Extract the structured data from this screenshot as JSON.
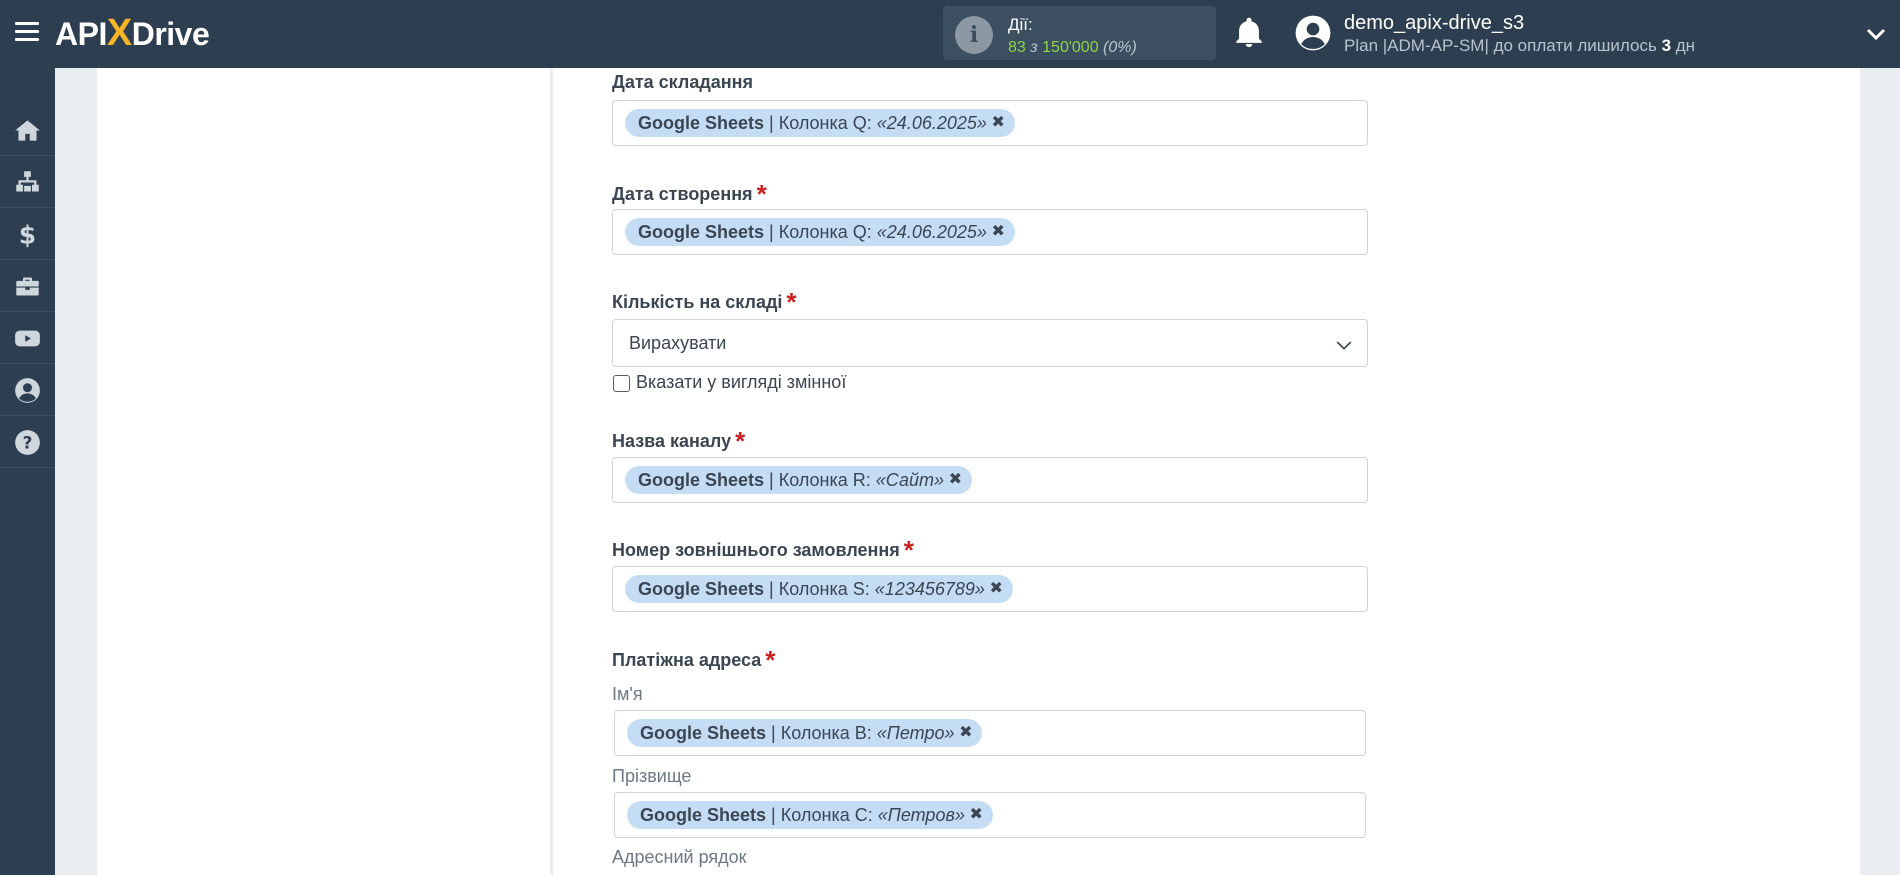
{
  "app": {
    "logo_pre": "API",
    "logo_x": "X",
    "logo_post": "Drive"
  },
  "header": {
    "actions_label": "Дії:",
    "actions_used": "83",
    "actions_of": "з",
    "actions_total": "150'000",
    "actions_percent": "(0%)",
    "user_name": "demo_apix-drive_s3",
    "plan_prefix": "Plan |ADM-AP-SM| до оплати лишилось",
    "plan_days": "3",
    "plan_suffix": "дн"
  },
  "sidebar": {
    "items": [
      {
        "name": "home-icon"
      },
      {
        "name": "sitemap-icon"
      },
      {
        "name": "dollar-icon"
      },
      {
        "name": "briefcase-icon"
      },
      {
        "name": "youtube-icon"
      },
      {
        "name": "user-circle-icon"
      },
      {
        "name": "help-icon"
      }
    ]
  },
  "form": {
    "date_compiled": {
      "label": "Дата складання",
      "tag": {
        "source": "Google Sheets",
        "column": "| Колонка Q:",
        "value": "«24.06.2025»"
      }
    },
    "date_created": {
      "label": "Дата створення",
      "tag": {
        "source": "Google Sheets",
        "column": "| Колонка Q:",
        "value": "«24.06.2025»"
      }
    },
    "stock_quantity": {
      "label": "Кількість на складі",
      "value": "Вирахувати",
      "checkbox_label": "Вказати у вигляді змінної"
    },
    "channel_name": {
      "label": "Назва каналу",
      "tag": {
        "source": "Google Sheets",
        "column": "| Колонка R:",
        "value": "«Сайт»"
      }
    },
    "external_order": {
      "label": "Номер зовнішнього замовлення",
      "tag": {
        "source": "Google Sheets",
        "column": "| Колонка S:",
        "value": "«123456789»"
      }
    },
    "billing_address": {
      "label": "Платіжна адреса",
      "first_name": {
        "label": "Ім'я",
        "tag": {
          "source": "Google Sheets",
          "column": "| Колонка B:",
          "value": "«Петро»"
        }
      },
      "last_name": {
        "label": "Прізвище",
        "tag": {
          "source": "Google Sheets",
          "column": "| Колонка C:",
          "value": "«Петров»"
        }
      },
      "address_line_label": "Адресний рядок"
    },
    "required_mark": "*",
    "remove_glyph": "✖"
  }
}
